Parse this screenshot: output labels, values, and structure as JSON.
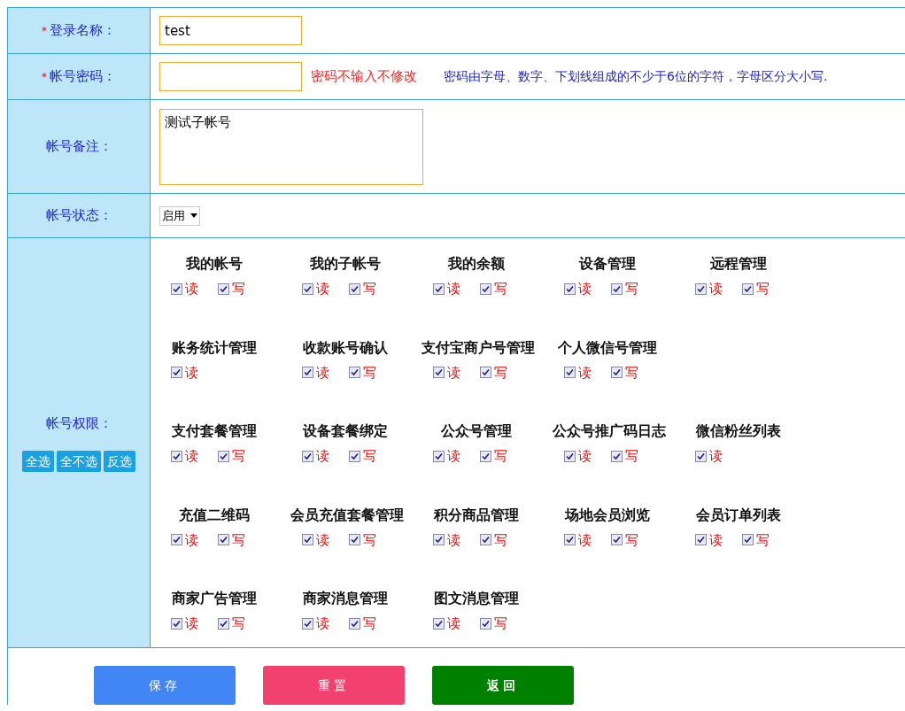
{
  "fields": [
    {
      "kind": "text",
      "label": "登录名称：",
      "required_mark": "*",
      "value": "test"
    },
    {
      "kind": "password",
      "label": "帐号密码：",
      "required_mark": "*",
      "note": "密码不输入不修改",
      "hint": "密码由字母、数字、下划线组成的不少于6位的字符，字母区分大小写."
    },
    {
      "kind": "textarea",
      "label": "帐号备注：",
      "value": "测试子帐号"
    },
    {
      "kind": "select",
      "label": "帐号状态：",
      "value": "启用"
    }
  ],
  "permissions": {
    "label": "帐号权限：",
    "actions": [
      "全选",
      "全不选",
      "反选"
    ],
    "rows": [
      [
        {
          "name": "我的帐号",
          "read": {
            "label": "读",
            "checked": true
          },
          "write": {
            "label": "写",
            "checked": true
          }
        },
        {
          "name": "我的子帐号",
          "read": {
            "label": "读",
            "checked": true
          },
          "write": {
            "label": "写",
            "checked": true
          }
        },
        {
          "name": "我的余额",
          "read": {
            "label": "读",
            "checked": true
          },
          "write": {
            "label": "写",
            "checked": true
          }
        },
        {
          "name": "设备管理",
          "read": {
            "label": "读",
            "checked": true
          },
          "write": {
            "label": "写",
            "checked": true
          }
        },
        {
          "name": "远程管理",
          "read": {
            "label": "读",
            "checked": true
          },
          "write": {
            "label": "写",
            "checked": true
          }
        }
      ],
      [
        {
          "name": "账务统计管理",
          "read": {
            "label": "读",
            "checked": true
          }
        },
        {
          "name": "收款账号确认",
          "read": {
            "label": "读",
            "checked": true
          },
          "write": {
            "label": "写",
            "checked": true
          }
        },
        {
          "name": "支付宝商户号管理",
          "read": {
            "label": "读",
            "checked": true
          },
          "write": {
            "label": "写",
            "checked": true
          }
        },
        {
          "name": "个人微信号管理",
          "read": {
            "label": "读",
            "checked": true
          },
          "write": {
            "label": "写",
            "checked": true
          }
        }
      ],
      [
        {
          "name": "支付套餐管理",
          "read": {
            "label": "读",
            "checked": true
          },
          "write": {
            "label": "写",
            "checked": true
          }
        },
        {
          "name": "设备套餐绑定",
          "read": {
            "label": "读",
            "checked": true
          },
          "write": {
            "label": "写",
            "checked": true
          }
        },
        {
          "name": "公众号管理",
          "read": {
            "label": "读",
            "checked": true
          },
          "write": {
            "label": "写",
            "checked": true
          }
        },
        {
          "name": "公众号推广码日志",
          "read": {
            "label": "读",
            "checked": true
          },
          "write": {
            "label": "写",
            "checked": true
          }
        },
        {
          "name": "微信粉丝列表",
          "read": {
            "label": "读",
            "checked": true
          }
        }
      ],
      [
        {
          "name": "充值二维码",
          "read": {
            "label": "读",
            "checked": true
          },
          "write": {
            "label": "写",
            "checked": true
          }
        },
        {
          "name": "会员充值套餐管理",
          "read": {
            "label": "读",
            "checked": true
          },
          "write": {
            "label": "写",
            "checked": true
          }
        },
        {
          "name": "积分商品管理",
          "read": {
            "label": "读",
            "checked": true
          },
          "write": {
            "label": "写",
            "checked": true
          }
        },
        {
          "name": "场地会员浏览",
          "read": {
            "label": "读",
            "checked": true
          },
          "write": {
            "label": "写",
            "checked": true
          }
        },
        {
          "name": "会员订单列表",
          "read": {
            "label": "读",
            "checked": true
          },
          "write": {
            "label": "写",
            "checked": true
          }
        }
      ],
      [
        {
          "name": "商家广告管理",
          "read": {
            "label": "读",
            "checked": true
          },
          "write": {
            "label": "写",
            "checked": true
          }
        },
        {
          "name": "商家消息管理",
          "read": {
            "label": "读",
            "checked": true
          },
          "write": {
            "label": "写",
            "checked": true
          }
        },
        {
          "name": "图文消息管理",
          "read": {
            "label": "读",
            "checked": true
          },
          "write": {
            "label": "写",
            "checked": true
          }
        }
      ]
    ]
  },
  "buttons": [
    {
      "kind": "save",
      "label": "保存"
    },
    {
      "kind": "reset",
      "label": "重置"
    },
    {
      "kind": "back",
      "label": "返回"
    }
  ]
}
